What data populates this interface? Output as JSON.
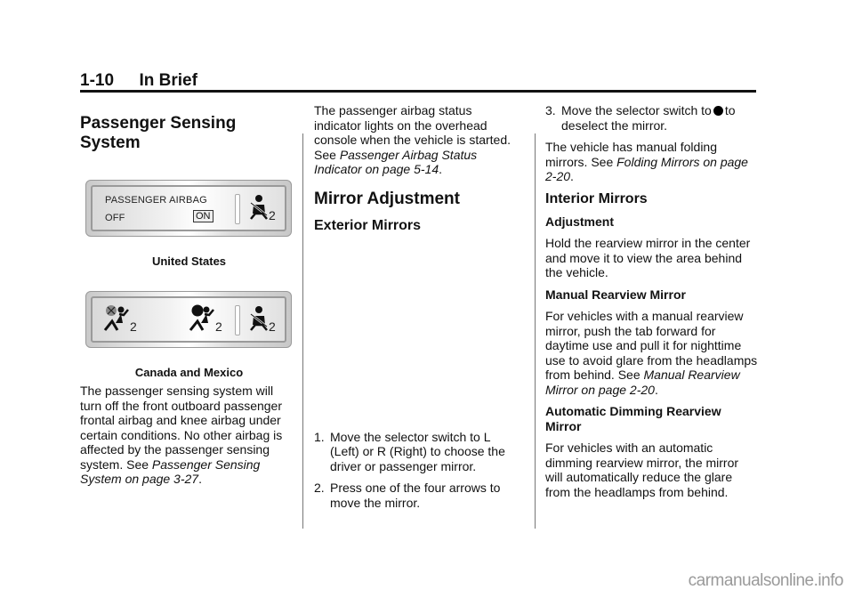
{
  "header": {
    "page_number": "1-10",
    "section": "In Brief"
  },
  "column1": {
    "title": "Passenger Sensing System",
    "panel_us": {
      "line1": "PASSENGER AIRBAG",
      "off_label": "OFF",
      "on_label": "ON",
      "seat_index": "2",
      "icon": "seatbelt-passenger-icon"
    },
    "caption_us": "United States",
    "panel_ca": {
      "icons": [
        "airbag-off-icon",
        "airbag-on-icon",
        "seatbelt-passenger-icon"
      ],
      "subscripts": [
        "2",
        "2",
        "2"
      ]
    },
    "caption_ca": "Canada and Mexico",
    "para": "The passenger sensing system will turn off the front outboard passenger frontal airbag and knee airbag under certain conditions. No other airbag is affected by the passenger sensing system. See ",
    "para_ref": "Passenger Sensing System on page 3-27",
    "para_end": "."
  },
  "column2": {
    "para": "The passenger airbag status indicator lights on the overhead console when the vehicle is started. See ",
    "para_ref": "Passenger Airbag Status Indicator on page 5-14",
    "para_end": ".",
    "title": "Mirror Adjustment",
    "subtitle": "Exterior Mirrors",
    "steps": [
      {
        "num": "1.",
        "text": "Move the selector switch to L (Left) or R (Right) to choose the driver or passenger mirror."
      },
      {
        "num": "2.",
        "text": "Press one of the four arrows to move the mirror."
      }
    ]
  },
  "column3": {
    "step3_num": "3.",
    "step3_pre": "Move the selector switch to",
    "step3_post": "to deselect the mirror.",
    "folding_para": "The vehicle has manual folding mirrors. See ",
    "folding_ref": "Folding Mirrors on page 2-20",
    "folding_end": ".",
    "interior_title": "Interior Mirrors",
    "adjustment_title": "Adjustment",
    "adjustment_para": "Hold the rearview mirror in the center and move it to view the area behind the vehicle.",
    "manual_title": "Manual Rearview Mirror",
    "manual_para": "For vehicles with a manual rearview mirror, push the tab forward for daytime use and pull it for nighttime use to avoid glare from the headlamps from behind. See ",
    "manual_ref": "Manual Rearview Mirror on page 2-20",
    "manual_end": ".",
    "auto_title": "Automatic Dimming Rearview Mirror",
    "auto_para": "For vehicles with an automatic dimming rearview mirror, the mirror will automatically reduce the glare from the headlamps from behind."
  },
  "watermark": "carmanualsonline.info"
}
